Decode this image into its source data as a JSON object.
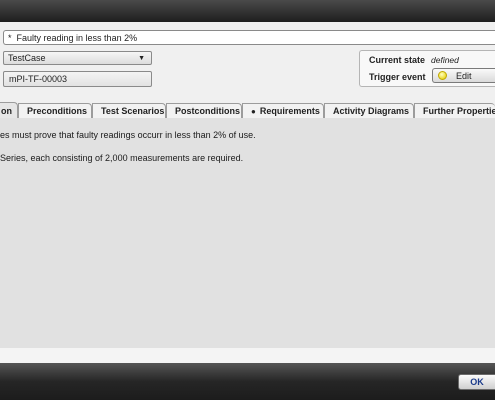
{
  "name_field": {
    "marker": "*",
    "value": "Faulty reading in less than 2%"
  },
  "type_select": {
    "value": "TestCase"
  },
  "id_field": {
    "value": "mPI-TF-00003"
  },
  "state_panel": {
    "current_state_label": "Current state",
    "current_state_value": "defined",
    "trigger_event_label": "Trigger event",
    "edit_label": "Edit"
  },
  "tabs": [
    {
      "label": "on",
      "active": true
    },
    {
      "label": "Preconditions"
    },
    {
      "label": "Test Scenarios"
    },
    {
      "label": "Postconditions"
    },
    {
      "label": "Requirements",
      "bullet": "●"
    },
    {
      "label": "Activity Diagrams"
    },
    {
      "label": "Further Properties"
    }
  ],
  "content": {
    "lines": [
      "es must prove that faulty readings occurr in less than 2% of use.",
      "Series, each consisting of 2,000 measurements are required."
    ]
  },
  "footer": {
    "ok_label": "OK"
  }
}
